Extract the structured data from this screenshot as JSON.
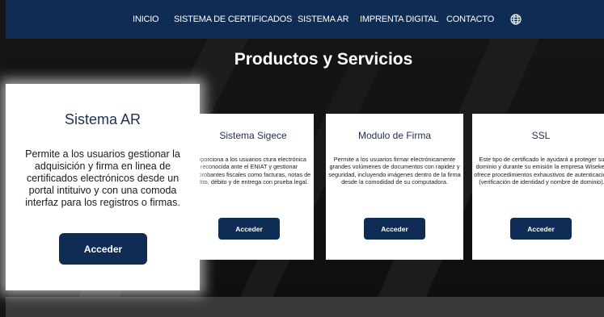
{
  "nav": {
    "items": [
      {
        "label": "INICIO"
      },
      {
        "label": "SISTEMA DE CERTIFICADOS"
      },
      {
        "label": "SISTEMA AR"
      },
      {
        "label": "IMPRENTA DIGITAL"
      },
      {
        "label": "CONTACTO"
      }
    ],
    "language_icon": "globe-icon"
  },
  "section": {
    "title": "Productos y Servicios"
  },
  "cards": [
    {
      "title": "Sistema AR",
      "description": "Permite a los usuarios gestionar la adquisición y firma en linea de certificados electrónicos desde un portal intituivo y con una comoda interfaz para los registros o firmas.",
      "button": "Acceder"
    },
    {
      "title": "Sistema Sigece",
      "description": "Proporciona a los usuarios ctura electrónica reconocida ante el ENIAT y gestionar comprobantes fiscales como facturas, notas de crédito, débito y de entrega con prueba legal.",
      "button": "Acceder"
    },
    {
      "title": "Modulo de Firma",
      "description": "Permite a los usuarios firmar electrónicamente grandes volúmenes de documentos con rapidez y seguridad, incluyendo imágenes dentro de la firma desde la comodidad de su computadora.",
      "button": "Acceder"
    },
    {
      "title": "SSL",
      "description": "Este tipo de certificado le ayudará a proteger su dominio y durante su emisión la empresa Wisekey ofrece procedimientos exhaustivos de autenticación (verificación de identidad y nombre de dominio).",
      "button": "Acceder"
    }
  ],
  "colors": {
    "nav_bg": "#0f2c54",
    "button_bg": "#0f2c54",
    "page_bg": "#161616",
    "card_bg": "#ffffff"
  }
}
